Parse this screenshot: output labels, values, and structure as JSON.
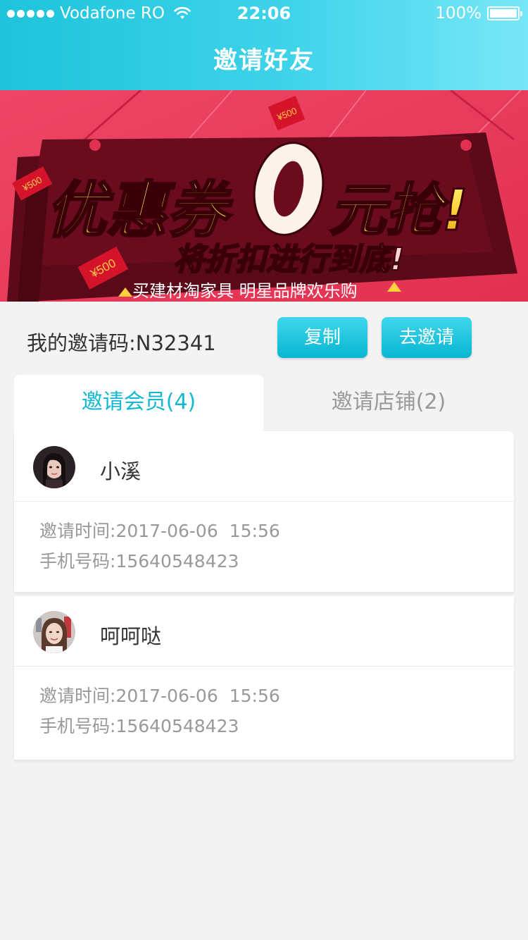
{
  "status_bar": {
    "carrier": "Vodafone RO",
    "time": "22:06",
    "battery": "100%"
  },
  "header": {
    "title": "邀请好友"
  },
  "banner": {
    "headline_prefix": "优惠券",
    "headline_zero": "0",
    "headline_suffix": "元抢!",
    "subhead": "将折扣进行到底!",
    "tagline": "买建材淘家具  明星品牌欢乐购",
    "tag_text": "¥500"
  },
  "invite": {
    "label": "我的邀请码:",
    "code": "N32341",
    "copy_button": "复制",
    "invite_button": "去邀请"
  },
  "tabs": [
    {
      "label": "邀请会员(4)",
      "active": true
    },
    {
      "label": "邀请店铺(2)",
      "active": false
    }
  ],
  "members": [
    {
      "name": "小溪",
      "time_label": "邀请时间:",
      "date": "2017-06-06",
      "time": "15:56",
      "phone_label": "手机号码:",
      "phone": "15640548423"
    },
    {
      "name": "呵呵哒",
      "time_label": "邀请时间:",
      "date": "2017-06-06",
      "time": "15:56",
      "phone_label": "手机号码:",
      "phone": "15640548423"
    }
  ],
  "colors": {
    "accent": "#13b8d3",
    "banner_bg": "#e8395a",
    "headline": "#ffd23a"
  }
}
